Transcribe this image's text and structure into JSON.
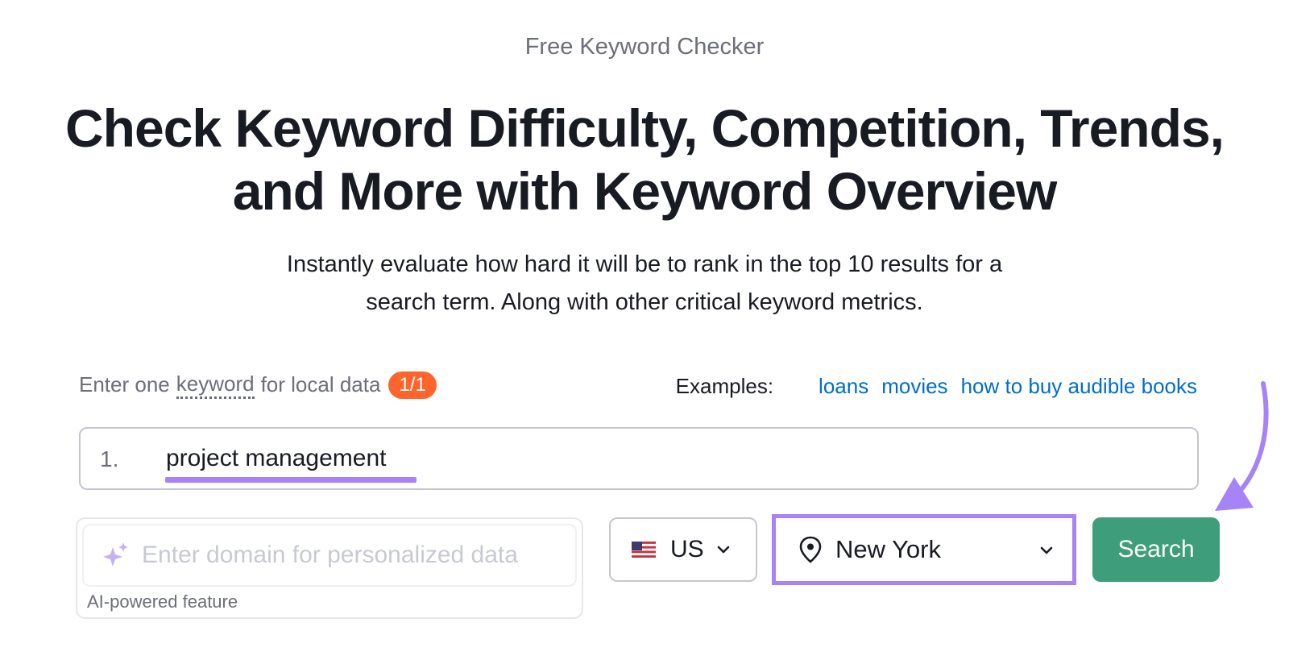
{
  "eyebrow": "Free Keyword Checker",
  "headline": {
    "line1": "Check Keyword Difficulty, Competition, Trends,",
    "line2": "and More with Keyword Overview"
  },
  "subhead": {
    "line1": "Instantly evaluate how hard it will be to rank in the top 10 results for a",
    "line2": "search term. Along with other critical keyword metrics."
  },
  "hint": {
    "prefix": "Enter one",
    "keyword": "keyword",
    "suffix": "for local data",
    "badge": "1/1"
  },
  "examples": {
    "label": "Examples:",
    "links": [
      "loans",
      "movies",
      "how to buy audible books"
    ]
  },
  "keyword_input": {
    "number": "1.",
    "value": "project management"
  },
  "domain_input": {
    "placeholder": "Enter domain for personalized data",
    "note": "AI-powered feature",
    "icon": "sparkle-icon"
  },
  "country": {
    "code": "US",
    "flag": "us-flag-icon"
  },
  "location": {
    "value": "New York",
    "icon": "location-pin-icon"
  },
  "search_button": {
    "label": "Search"
  },
  "colors": {
    "accent_purple": "#a683f7",
    "button_green": "#3e9d7a",
    "badge_orange": "#ff642d",
    "link_blue": "#006dca"
  }
}
